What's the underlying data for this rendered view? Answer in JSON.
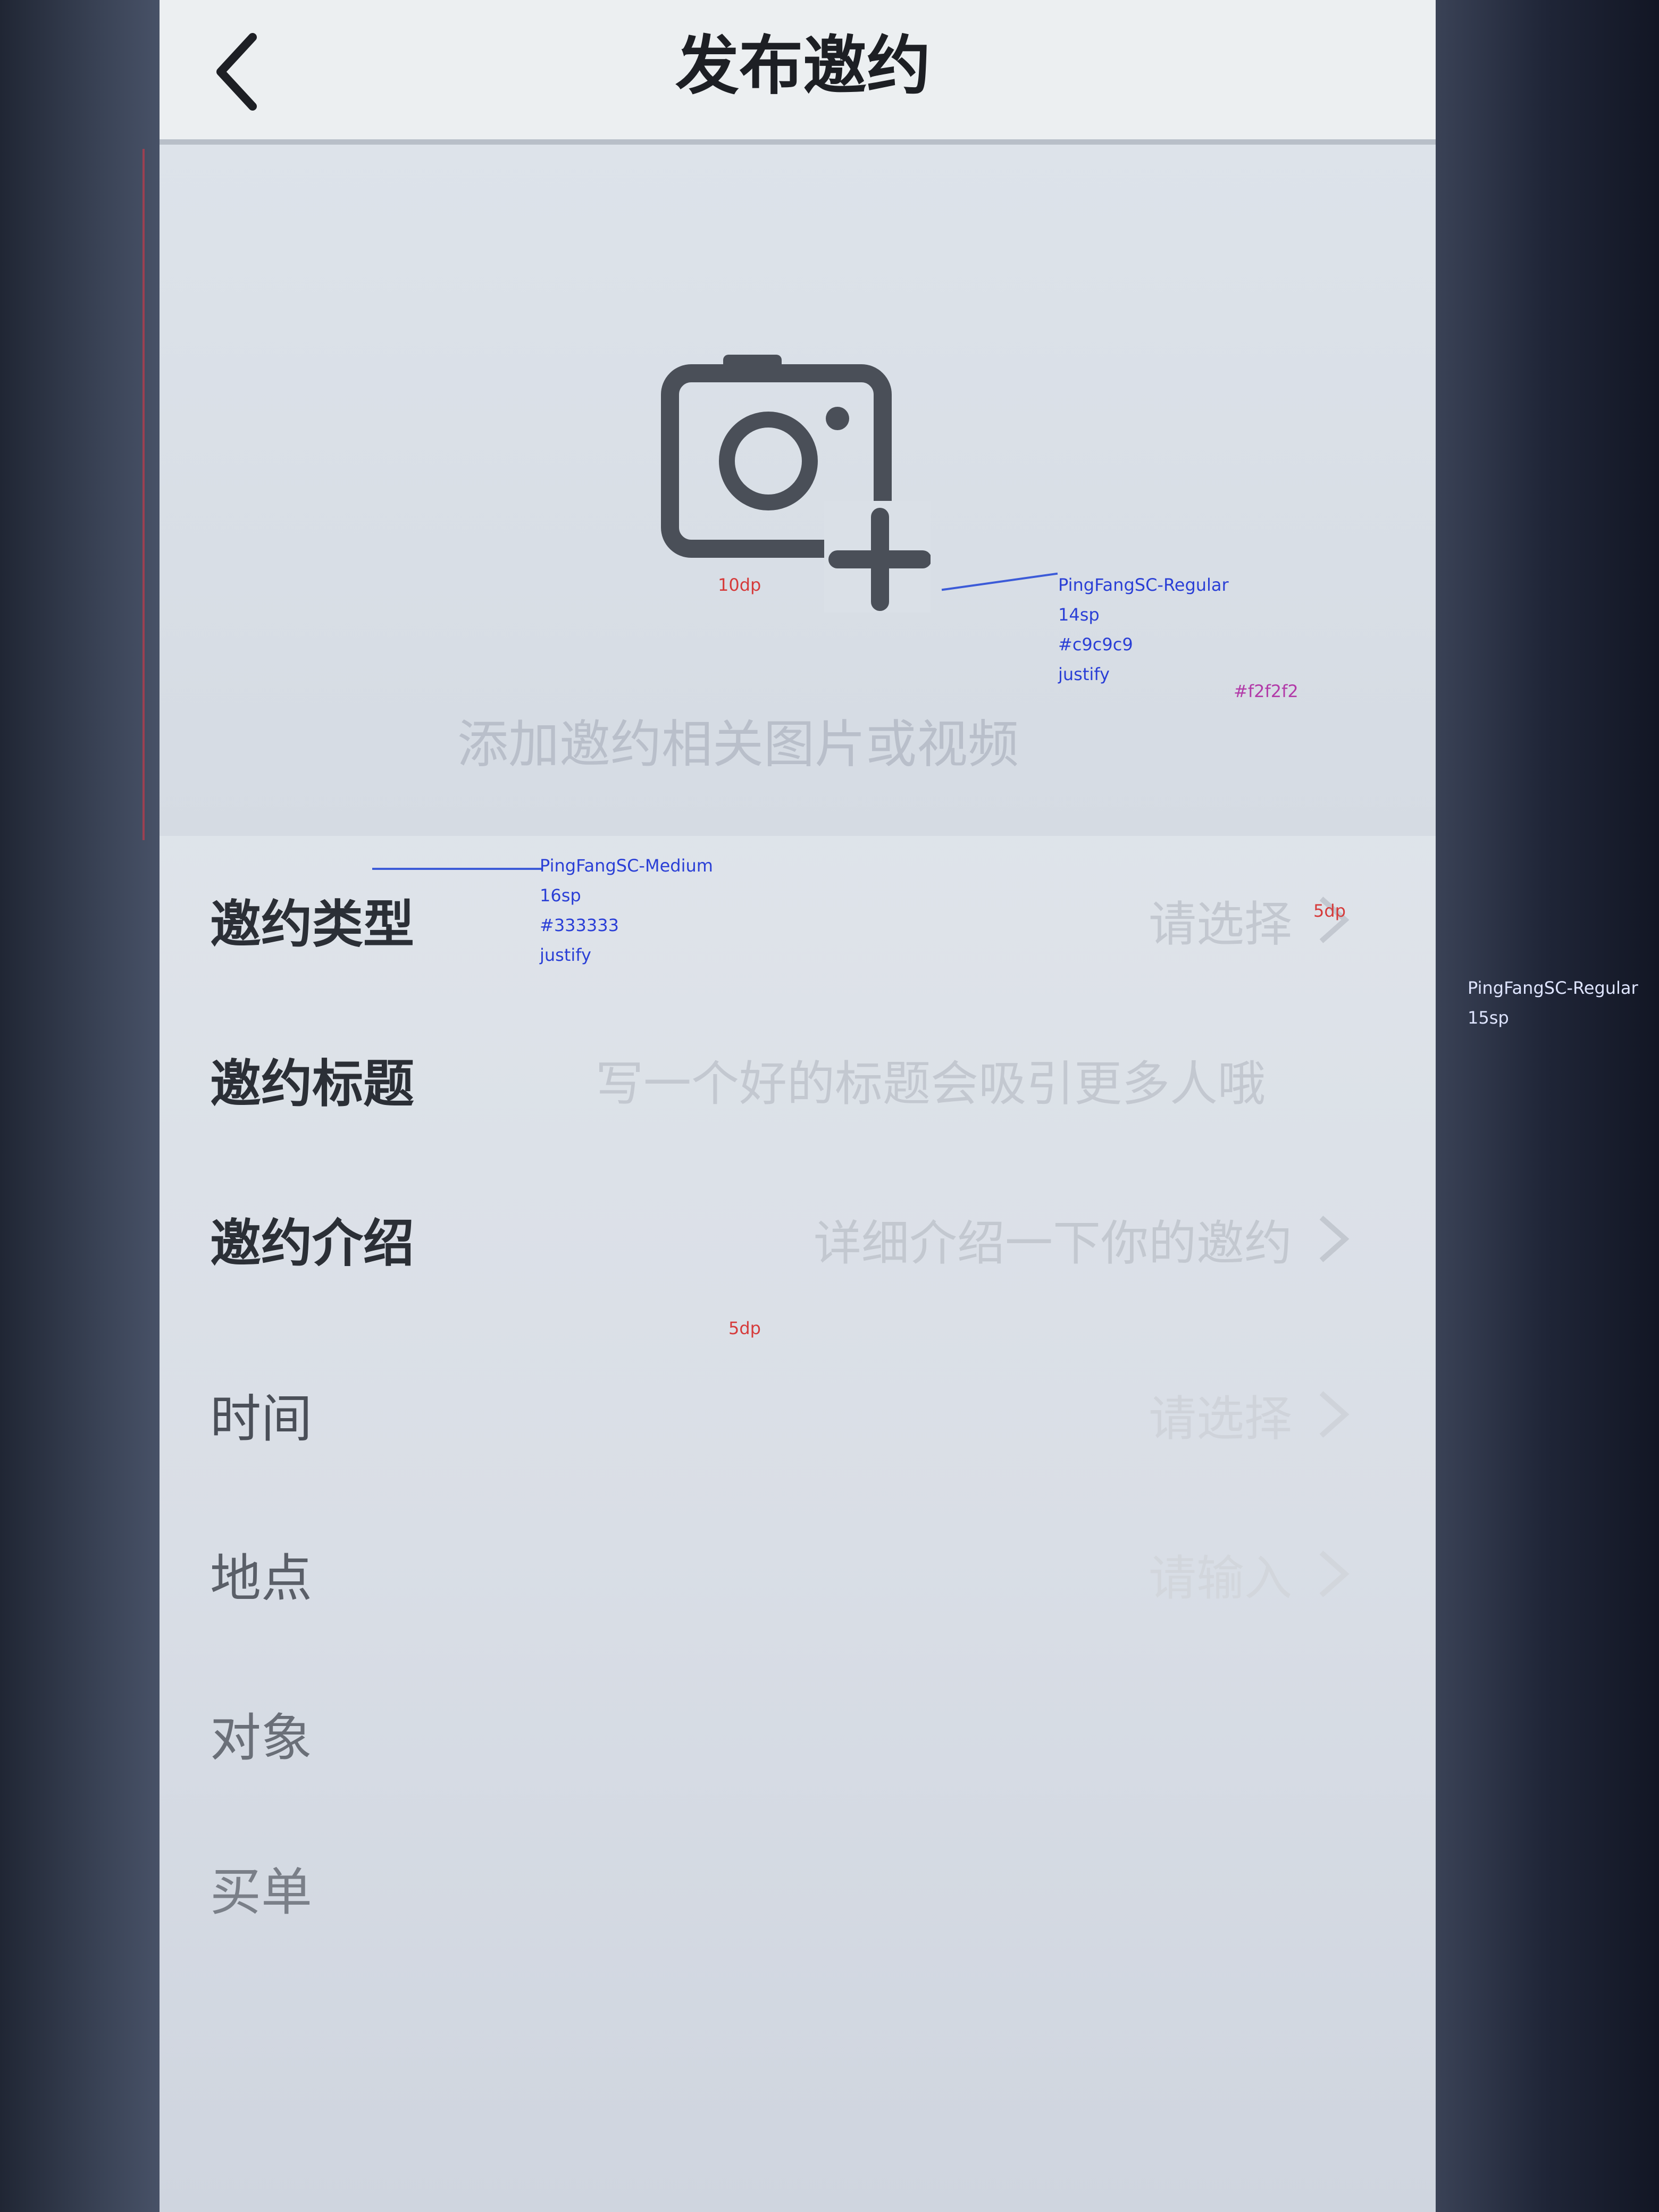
{
  "navbar": {
    "title": "发布邀约",
    "back_icon": "chevron-left-icon"
  },
  "upload": {
    "icon": "camera-add-icon",
    "hint": "添加邀约相关图片或视频"
  },
  "form": {
    "rows": [
      {
        "label": "邀约类型",
        "value": "请选择"
      },
      {
        "label": "邀约标题",
        "value": "写一个好的标题会吸引更多人哦"
      },
      {
        "label": "邀约介绍",
        "value": "详细介绍一下你的邀约"
      },
      {
        "label": "时间",
        "value": "请选择"
      },
      {
        "label": "地点",
        "value": "请输入"
      },
      {
        "label": "对象",
        "value": ""
      },
      {
        "label": "买单",
        "value": ""
      }
    ]
  },
  "annotations": {
    "hint_spec": [
      "PingFangSC-Regular",
      "14sp",
      "#c9c9c9",
      "justify"
    ],
    "label_spec": [
      "PingFangSC-Medium",
      "16sp",
      "#333333",
      "justify"
    ],
    "title_spec": [
      "PingFangSC-Regular",
      "15sp"
    ],
    "gap_10": "10dp",
    "gap_5": "5dp",
    "gap_5b": "5dp",
    "bg_color": "#f2f2f2"
  },
  "colors": {
    "label_primary": "#333333",
    "placeholder": "#c9c9c9",
    "annotation_blue": "#2a3fd6",
    "annotation_purple": "#b23aa8"
  }
}
